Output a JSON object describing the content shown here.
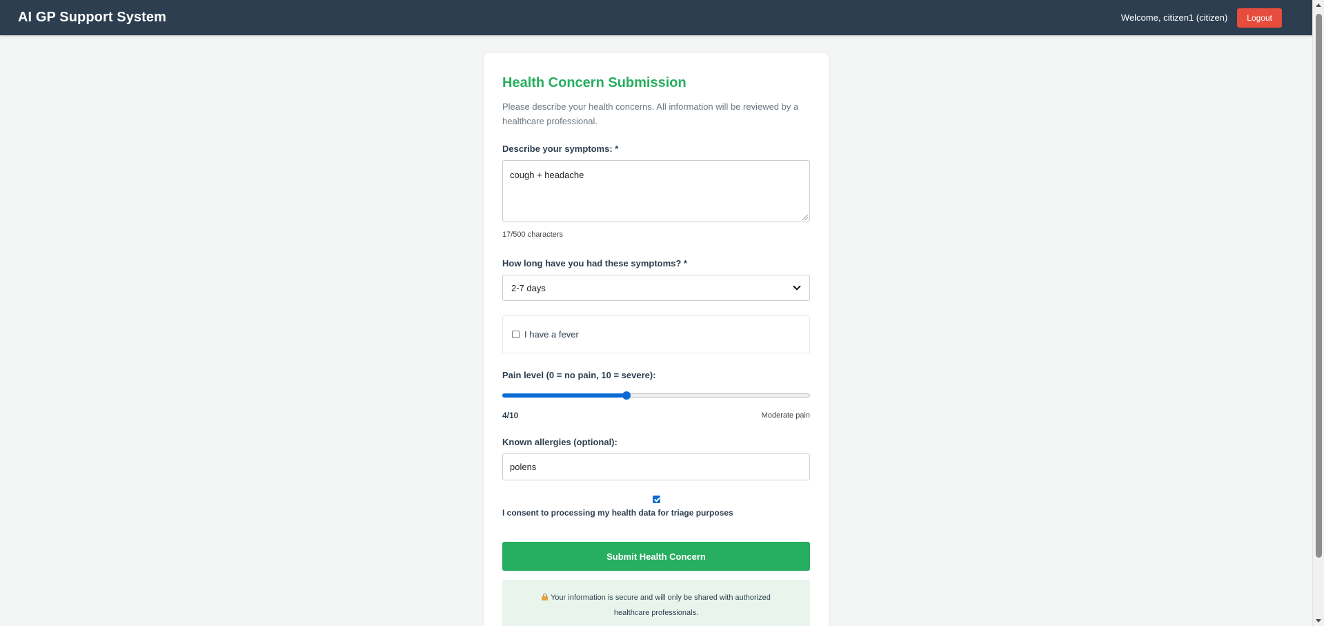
{
  "header": {
    "app_title": "AI GP Support System",
    "welcome_text": "Welcome, citizen1 (citizen)",
    "logout_label": "Logout"
  },
  "form": {
    "title": "Health Concern Submission",
    "intro": "Please describe your health concerns. All information will be reviewed by a healthcare professional.",
    "symptoms": {
      "label": "Describe your symptoms: *",
      "value": "cough + headache",
      "char_count": "17/500 characters"
    },
    "duration": {
      "label": "How long have you had these symptoms? *",
      "selected": "2-7 days"
    },
    "fever": {
      "label": "I have a fever",
      "checked": false
    },
    "pain": {
      "label": "Pain level (0 = no pain, 10 = severe):",
      "value": 4,
      "max": 10,
      "value_text": "4/10",
      "description": "Moderate pain"
    },
    "allergies": {
      "label": "Known allergies (optional):",
      "value": "polens"
    },
    "consent": {
      "label": "I consent to processing my health data for triage purposes",
      "checked": true
    },
    "submit_label": "Submit Health Concern",
    "secure_notice": "Your information is secure and will only be shared with authorized healthcare professionals."
  },
  "colors": {
    "header_bg": "#2c3e50",
    "accent_green": "#27ae60",
    "logout_red": "#e74c3c",
    "slider_blue": "#0b6bd6",
    "notice_bg": "#e9f5ec"
  },
  "icons": {
    "secure_notice_icon": "lock-icon"
  }
}
